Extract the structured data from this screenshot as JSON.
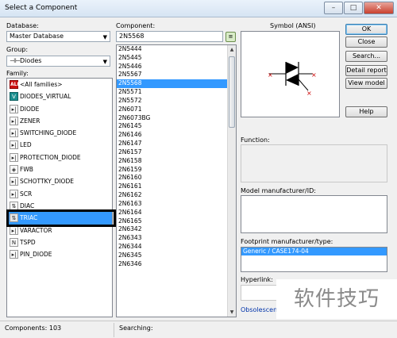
{
  "window": {
    "title": "Select a Component",
    "controls": {
      "minimize": "–",
      "maximize": "□",
      "close": "✕"
    }
  },
  "left": {
    "database_label": "Database:",
    "database_value": "Master Database",
    "group_label": "Group:",
    "group_value": "Diodes",
    "family_label": "Family:",
    "families": [
      {
        "label": "<All families>",
        "icon": "ALL",
        "kind": "allfam"
      },
      {
        "label": "DIODES_VIRTUAL",
        "icon": "V",
        "kind": "virt"
      },
      {
        "label": "DIODE",
        "icon": "▸|",
        "kind": ""
      },
      {
        "label": "ZENER",
        "icon": "▸|",
        "kind": ""
      },
      {
        "label": "SWITCHING_DIODE",
        "icon": "▸|",
        "kind": ""
      },
      {
        "label": "LED",
        "icon": "▸|",
        "kind": ""
      },
      {
        "label": "PROTECTION_DIODE",
        "icon": "▸|",
        "kind": ""
      },
      {
        "label": "FWB",
        "icon": "◈",
        "kind": ""
      },
      {
        "label": "SCHOTTKY_DIODE",
        "icon": "▸|",
        "kind": ""
      },
      {
        "label": "SCR",
        "icon": "▸|",
        "kind": ""
      },
      {
        "label": "DIAC",
        "icon": "⇅",
        "kind": ""
      },
      {
        "label": "TRIAC",
        "icon": "⇅",
        "kind": "selected"
      },
      {
        "label": "VARACTOR",
        "icon": "▸|",
        "kind": ""
      },
      {
        "label": "TSPD",
        "icon": "N",
        "kind": ""
      },
      {
        "label": "PIN_DIODE",
        "icon": "▸|",
        "kind": ""
      }
    ]
  },
  "middle": {
    "component_label": "Component:",
    "component_value": "2N5568",
    "components": [
      "2N5444",
      "2N5445",
      "2N5446",
      "2N5567",
      "2N5568",
      "2N5571",
      "2N5572",
      "2N6071",
      "2N6073BG",
      "2N6145",
      "2N6146",
      "2N6147",
      "2N6157",
      "2N6158",
      "2N6159",
      "2N6160",
      "2N6161",
      "2N6162",
      "2N6163",
      "2N6164",
      "2N6165",
      "2N6342",
      "2N6343",
      "2N6344",
      "2N6345",
      "2N6346"
    ],
    "selected_component": "2N5568"
  },
  "right": {
    "symbol_label": "Symbol (ANSI)",
    "function_label": "Function:",
    "model_label": "Model manufacturer/ID:",
    "footprint_label": "Footprint manufacturer/type:",
    "footprint_value": "Generic / CASE174-04",
    "hyperlink_label": "Hyperlink:",
    "obsolescence_label": "Obsolescence"
  },
  "buttons": {
    "ok": "OK",
    "close": "Close",
    "search": "Search...",
    "detail_report": "Detail report",
    "view_model": "View model",
    "help": "Help"
  },
  "status": {
    "components": "Components: 103",
    "searching": "Searching:"
  },
  "watermark": "软件技巧",
  "colors": {
    "selection": "#3399ff",
    "link": "#0033aa"
  }
}
